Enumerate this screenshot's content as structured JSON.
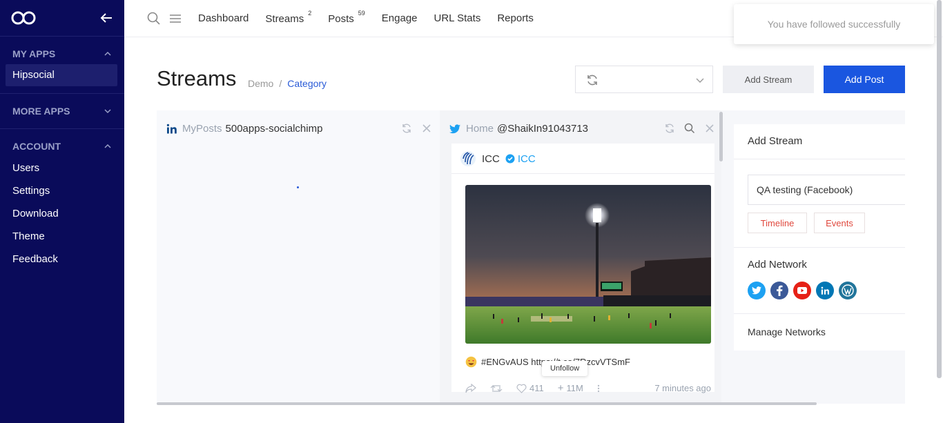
{
  "sidebar": {
    "sections": [
      {
        "title": "MY APPS",
        "items": [
          "Hipsocial"
        ]
      },
      {
        "title": "MORE APPS",
        "items": []
      },
      {
        "title": "ACCOUNT",
        "items": [
          "Users",
          "Settings",
          "Download",
          "Theme",
          "Feedback"
        ]
      }
    ]
  },
  "topbar": {
    "nav": [
      {
        "label": "Dashboard",
        "badge": ""
      },
      {
        "label": "Streams",
        "badge": "2"
      },
      {
        "label": "Posts",
        "badge": "59"
      },
      {
        "label": "Engage",
        "badge": ""
      },
      {
        "label": "URL Stats",
        "badge": ""
      },
      {
        "label": "Reports",
        "badge": ""
      }
    ]
  },
  "toast": {
    "message": "You have followed successfully"
  },
  "header": {
    "title": "Streams",
    "breadcrumb": {
      "root": "Demo",
      "sep": "/",
      "current": "Category"
    },
    "add_stream": "Add Stream",
    "add_post": "Add Post"
  },
  "stream1": {
    "prefix": "MyPosts",
    "name": "500apps-socialchimp"
  },
  "stream2": {
    "prefix": "Home",
    "handle": "@ShaikIn91043713",
    "post": {
      "author": "ICC",
      "author_handle": "ICC",
      "text": "#ENGvAUS https://t.co/7RzcvVTSmF",
      "likes": "411",
      "followers": "11M",
      "time": "7 minutes ago",
      "tooltip": "Unfollow"
    }
  },
  "panel": {
    "add_stream_title": "Add Stream",
    "account": "QA testing (Facebook)",
    "timeline": "Timeline",
    "events": "Events",
    "add_network_title": "Add Network",
    "manage": "Manage Networks"
  },
  "colors": {
    "sidebar_bg": "#0a0b5a",
    "primary": "#1a56e0",
    "twitter": "#1da1f2",
    "facebook": "#3b5998",
    "youtube": "#e62117",
    "linkedin": "#0077b5",
    "wordpress": "#21759b"
  }
}
